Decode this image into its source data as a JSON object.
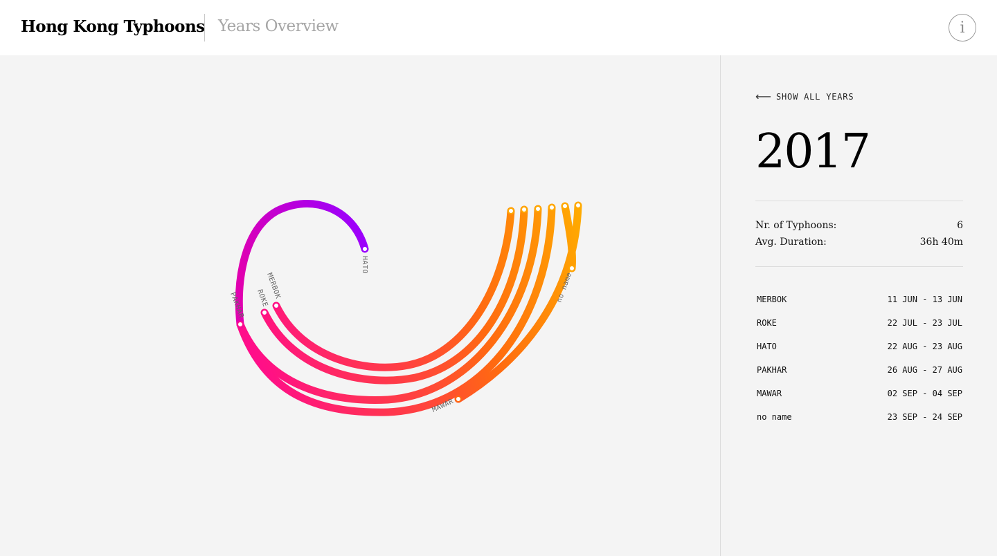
{
  "header": {
    "title": "Hong Kong Typhoons",
    "subtitle": "Years Overview",
    "info_icon": "i"
  },
  "panel": {
    "back_arrow": "⟵",
    "back_label": "SHOW ALL YEARS",
    "year": "2017",
    "stats": [
      {
        "label": "Nr. of Typhoons:",
        "value": "6"
      },
      {
        "label": "Avg. Duration:",
        "value": "36h 40m"
      }
    ],
    "typhoons": [
      {
        "name": "MERBOK",
        "dates": "11 JUN - 13 JUN"
      },
      {
        "name": "ROKE",
        "dates": "22 JUL - 23 JUL"
      },
      {
        "name": "HATO",
        "dates": "22 AUG - 23 AUG"
      },
      {
        "name": "PAKHAR",
        "dates": "26 AUG - 27 AUG"
      },
      {
        "name": "MAWAR",
        "dates": "02 SEP - 04 SEP"
      },
      {
        "name": "no name",
        "dates": "23 SEP - 24 SEP"
      }
    ]
  },
  "viz": {
    "arc_labels": [
      "HATO",
      "MERBOK",
      "ROKE",
      "PAKHAR",
      "no name",
      "MAWAR"
    ],
    "colors": {
      "purple": "#9900ff",
      "magenta": "#e600a0",
      "pink": "#ff1a6e",
      "red": "#ff3d3d",
      "orange": "#ff6a00",
      "amber": "#ffa500"
    }
  }
}
